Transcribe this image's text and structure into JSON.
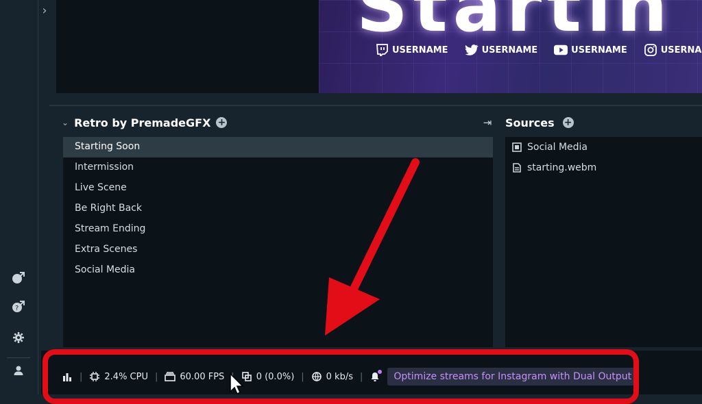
{
  "preview": {
    "title_text": "Startin",
    "socials": [
      {
        "platform": "twitch",
        "icon": "twitch-icon",
        "label": "USERNAME"
      },
      {
        "platform": "twitter",
        "icon": "twitter-icon",
        "label": "USERNAME"
      },
      {
        "platform": "youtube",
        "icon": "youtube-icon",
        "label": "USERNAME"
      },
      {
        "platform": "instagram",
        "icon": "instagram-icon",
        "label": "USERNAME"
      }
    ]
  },
  "scenes": {
    "title": "Retro by PremadeGFX",
    "items": [
      {
        "label": "Starting Soon",
        "selected": true
      },
      {
        "label": "Intermission"
      },
      {
        "label": "Live Scene"
      },
      {
        "label": "Be Right Back"
      },
      {
        "label": "Stream Ending"
      },
      {
        "label": "Extra Scenes"
      },
      {
        "label": "Social Media"
      }
    ]
  },
  "sources": {
    "title": "Sources",
    "items": [
      {
        "label": "Social Media",
        "icon": "scene-icon"
      },
      {
        "label": "starting.webm",
        "icon": "file-icon"
      }
    ]
  },
  "status": {
    "cpu": "2.4% CPU",
    "fps": "60.00 FPS",
    "dropped": "0 (0.0%)",
    "bandwidth": "0 kb/s",
    "promo": "Optimize streams for Instagram with Dual Output"
  },
  "colors": {
    "background": "#17242d",
    "panel": "#0b1319",
    "selected": "#2d3c45",
    "annotation_red": "#e30d18",
    "promo_text": "#c591f6"
  }
}
